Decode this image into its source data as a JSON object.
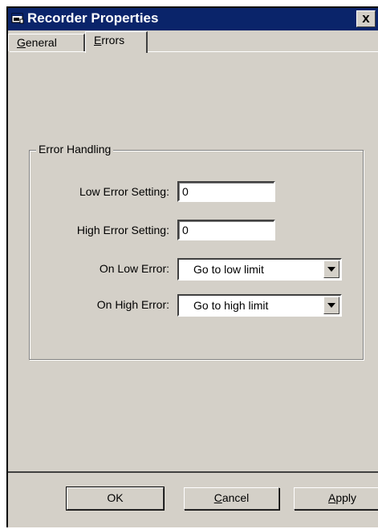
{
  "window": {
    "title": "Recorder Properties",
    "close_label": "x"
  },
  "tabs": [
    {
      "label_key": "G",
      "label_rest": "eneral",
      "active": false
    },
    {
      "label_key": "E",
      "label_rest": "rrors",
      "active": true
    }
  ],
  "error_handling": {
    "group_label": "Error Handling",
    "low_error_setting": {
      "label": "Low Error Setting:",
      "value": "0"
    },
    "high_error_setting": {
      "label": "High Error Setting:",
      "value": "0"
    },
    "on_low_error": {
      "label": "On Low Error:",
      "selected": "Go to low limit"
    },
    "on_high_error": {
      "label": "On High Error:",
      "selected": "Go to high limit"
    }
  },
  "buttons": {
    "ok": "OK",
    "cancel_key": "C",
    "cancel_rest": "ancel",
    "apply_key": "A",
    "apply_rest": "pply"
  },
  "colors": {
    "titlebar": "#0a246a",
    "face": "#d4d0c8"
  },
  "icons": {
    "title": "window-app-icon",
    "dropdown": "triangle-down-icon"
  }
}
